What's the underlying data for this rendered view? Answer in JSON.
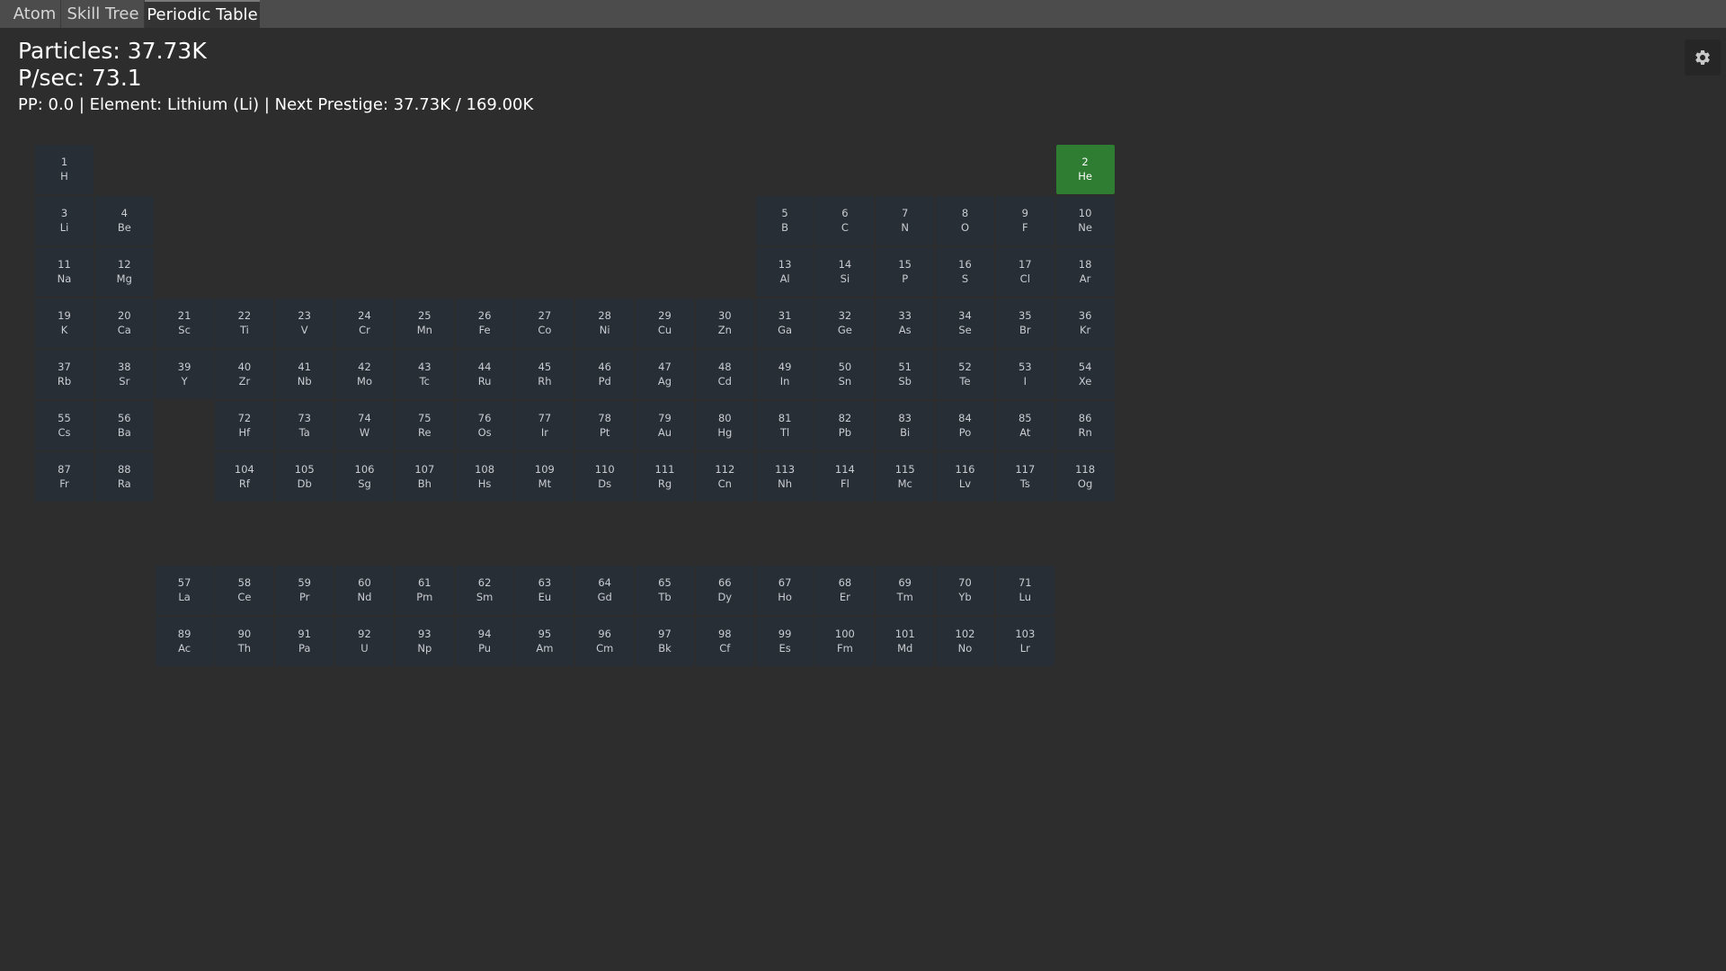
{
  "tabs": [
    {
      "label": "Atom",
      "active": false
    },
    {
      "label": "Skill Tree",
      "active": false
    },
    {
      "label": "Periodic Table",
      "active": true
    }
  ],
  "stats": {
    "particles": "Particles: 37.73K",
    "psec": "P/sec: 73.1",
    "prestige_line": "PP: 0.0 | Element: Lithium (Li) | Next Prestige: 37.73K / 169.00K"
  },
  "settings": {
    "icon": "gear-icon"
  },
  "colors": {
    "active_element": "#2e7d32",
    "cell": "#282e36",
    "background": "#2d2d2d"
  },
  "table": {
    "active_number": 2,
    "symbols": [
      "H",
      "He",
      "Li",
      "Be",
      "B",
      "C",
      "N",
      "O",
      "F",
      "Ne",
      "Na",
      "Mg",
      "Al",
      "Si",
      "P",
      "S",
      "Cl",
      "Ar",
      "K",
      "Ca",
      "Sc",
      "Ti",
      "V",
      "Cr",
      "Mn",
      "Fe",
      "Co",
      "Ni",
      "Cu",
      "Zn",
      "Ga",
      "Ge",
      "As",
      "Se",
      "Br",
      "Kr",
      "Rb",
      "Sr",
      "Y",
      "Zr",
      "Nb",
      "Mo",
      "Tc",
      "Ru",
      "Rh",
      "Pd",
      "Ag",
      "Cd",
      "In",
      "Sn",
      "Sb",
      "Te",
      "I",
      "Xe",
      "Cs",
      "Ba",
      "La",
      "Ce",
      "Pr",
      "Nd",
      "Pm",
      "Sm",
      "Eu",
      "Gd",
      "Tb",
      "Dy",
      "Ho",
      "Er",
      "Tm",
      "Yb",
      "Lu",
      "Hf",
      "Ta",
      "W",
      "Re",
      "Os",
      "Ir",
      "Pt",
      "Au",
      "Hg",
      "Tl",
      "Pb",
      "Bi",
      "Po",
      "At",
      "Rn",
      "Fr",
      "Ra",
      "Ac",
      "Th",
      "Pa",
      "U",
      "Np",
      "Pu",
      "Am",
      "Cm",
      "Bk",
      "Cf",
      "Es",
      "Fm",
      "Md",
      "No",
      "Lr",
      "Rf",
      "Db",
      "Sg",
      "Bh",
      "Hs",
      "Mt",
      "Ds",
      "Rg",
      "Cn",
      "Nh",
      "Fl",
      "Mc",
      "Lv",
      "Ts",
      "Og"
    ]
  }
}
